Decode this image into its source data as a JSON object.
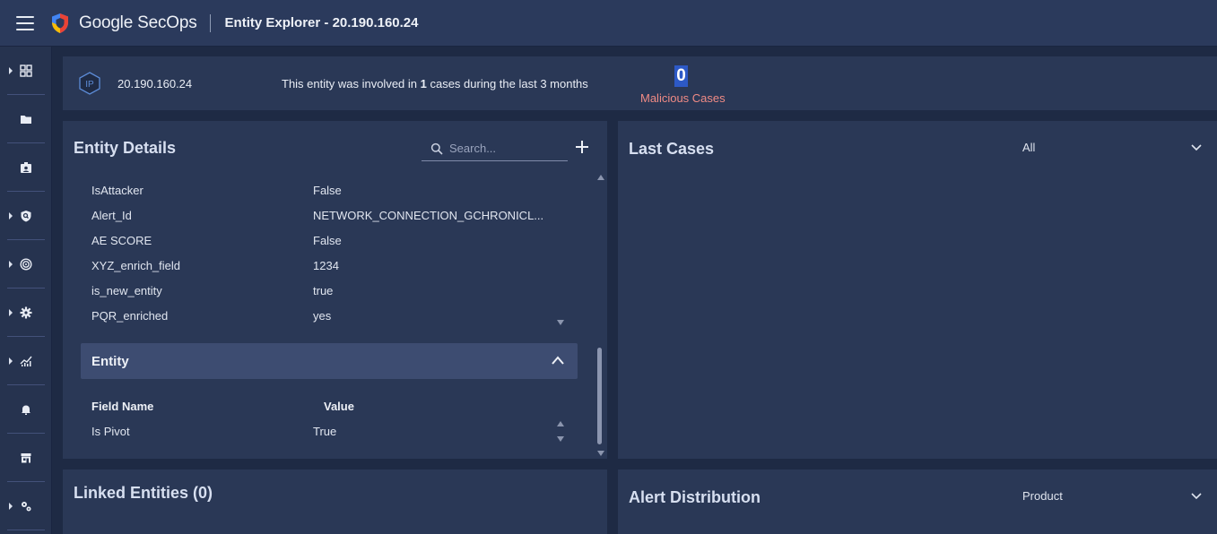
{
  "app": {
    "brand": "Google SecOps",
    "page_title": "Entity Explorer - 20.190.160.24"
  },
  "sidebar": {
    "items": [
      {
        "icon": "dashboard-grid-icon",
        "has_caret": true
      },
      {
        "icon": "folder-icon",
        "has_caret": false
      },
      {
        "icon": "id-badge-icon",
        "has_caret": false
      },
      {
        "icon": "shield-search-icon",
        "has_caret": true
      },
      {
        "icon": "radar-icon",
        "has_caret": true
      },
      {
        "icon": "gear-icon",
        "has_caret": true
      },
      {
        "icon": "analytics-chart-icon",
        "has_caret": true
      },
      {
        "icon": "bell-icon",
        "has_caret": false
      },
      {
        "icon": "marketplace-icon",
        "has_caret": false
      },
      {
        "icon": "settings-gears-icon",
        "has_caret": true
      }
    ]
  },
  "entity": {
    "type_badge": "IP",
    "identifier": "20.190.160.24",
    "involved_prefix": "This entity was involved in ",
    "involved_count": "1",
    "involved_suffix": " cases during the last 3 months",
    "malicious_count": "0",
    "malicious_label": "Malicious Cases"
  },
  "entity_details": {
    "title": "Entity Details",
    "search_placeholder": "Search...",
    "rows": [
      {
        "key": "IsAttacker",
        "value": "False"
      },
      {
        "key": "Alert_Id",
        "value": "NETWORK_CONNECTION_GCHRONICL..."
      },
      {
        "key": "AE SCORE",
        "value": "False"
      },
      {
        "key": "XYZ_enrich_field",
        "value": "1234"
      },
      {
        "key": "is_new_entity",
        "value": "true"
      },
      {
        "key": "PQR_enriched",
        "value": "yes"
      }
    ],
    "section": {
      "label": "Entity",
      "col_field": "Field Name",
      "col_value": "Value",
      "rows": [
        {
          "key": "Is Pivot",
          "value": "True"
        }
      ]
    }
  },
  "last_cases": {
    "title": "Last Cases",
    "filter_value": "All"
  },
  "linked_entities": {
    "title": "Linked Entities (0)"
  },
  "alert_distribution": {
    "title": "Alert Distribution",
    "filter_value": "Product"
  },
  "colors": {
    "malicious_label": "#f08b85",
    "count_highlight": "#2d59c6",
    "panel_bg": "#2a3856"
  }
}
